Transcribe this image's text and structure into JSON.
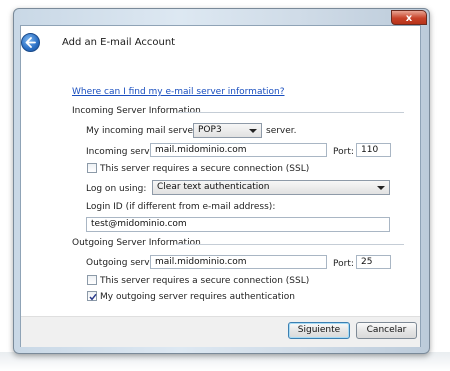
{
  "window": {
    "title": "Add an E-mail Account",
    "close_glyph": "x"
  },
  "link": "Where can I find my e-mail server information?",
  "incoming": {
    "section_title": "Incoming Server Information",
    "type_label": "My incoming mail server is a",
    "type_value": "POP3",
    "type_suffix": "server.",
    "server_label": "Incoming server:",
    "server_value": "mail.midominio.com",
    "port_label": "Port:",
    "port_value": "110",
    "ssl_label": "This server requires a secure connection (SSL)",
    "ssl_checked": false,
    "logon_label": "Log on using:",
    "logon_value": "Clear text authentication",
    "login_id_label": "Login ID (if different from e-mail address):",
    "login_id_value": "test@midominio.com"
  },
  "outgoing": {
    "section_title": "Outgoing Server Information",
    "server_label": "Outgoing server:",
    "server_value": "mail.midominio.com",
    "port_label": "Port:",
    "port_value": "25",
    "ssl_label": "This server requires a secure connection (SSL)",
    "ssl_checked": false,
    "auth_label": "My outgoing server requires authentication",
    "auth_checked": true
  },
  "buttons": {
    "next": "Siguiente",
    "cancel": "Cancelar"
  },
  "icons": {
    "back": "back-arrow-icon",
    "dropdown": "chevron-down-icon",
    "check": "checkmark-icon"
  }
}
